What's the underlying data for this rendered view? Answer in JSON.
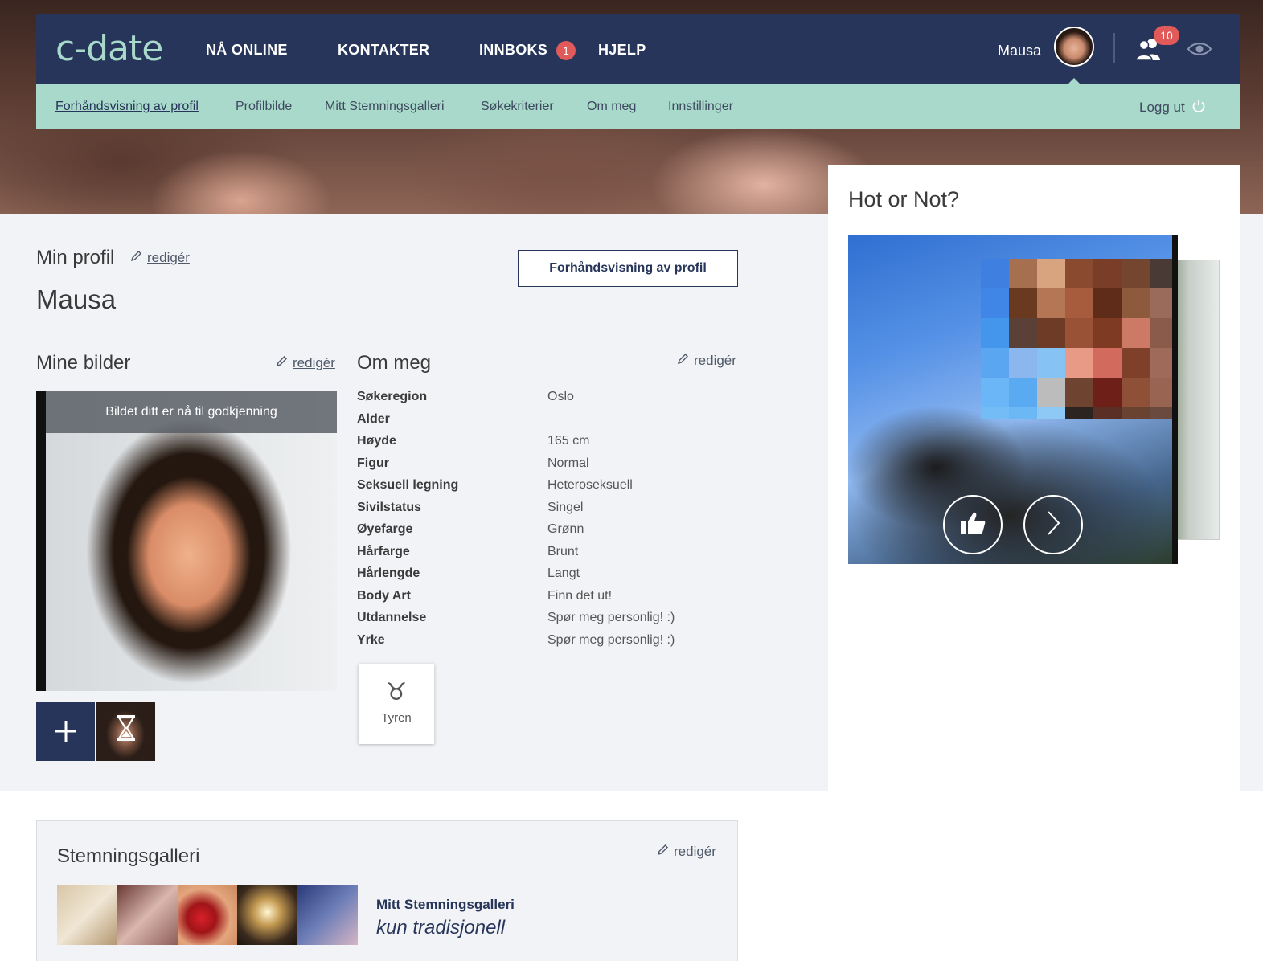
{
  "brand": {
    "logo": "c-date",
    "accent": "#263559",
    "subnav_bg": "#a9d9cb",
    "badge_color": "#e05a5a"
  },
  "topnav": {
    "items": [
      {
        "label": "NÅ ONLINE"
      },
      {
        "label": "KONTAKTER"
      },
      {
        "label": "INNBOKS",
        "badge": "1"
      },
      {
        "label": "HJELP"
      }
    ],
    "username": "Mausa",
    "contacts_badge": "10",
    "icons": [
      "avatar",
      "contacts-icon",
      "eye-icon"
    ]
  },
  "subnav": {
    "items": [
      {
        "label": "Forhåndsvisning av profil",
        "active": true
      },
      {
        "label": "Profilbilde"
      },
      {
        "label": "Mitt Stemningsgalleri"
      },
      {
        "label": "Søkekriterier"
      },
      {
        "label": "Om meg"
      },
      {
        "label": "Innstillinger"
      }
    ],
    "logout": "Logg ut"
  },
  "profile": {
    "section_title": "Min profil",
    "edit_label": "redigér",
    "name": "Mausa",
    "preview_button": "Forhåndsvisning av profil"
  },
  "photos": {
    "title": "Mine bilder",
    "edit_label": "redigér",
    "pending_banner": "Bildet ditt er nå til godkjenning",
    "add_icon": "plus-icon",
    "thumb_status_icon": "hourglass-icon"
  },
  "about": {
    "title": "Om meg",
    "edit_label": "redigér",
    "rows": [
      {
        "label": "Søkeregion",
        "value": "Oslo"
      },
      {
        "label": "Alder",
        "value": ""
      },
      {
        "label": "Høyde",
        "value": "165 cm"
      },
      {
        "label": "Figur",
        "value": "Normal"
      },
      {
        "label": "Seksuell legning",
        "value": "Heteroseksuell"
      },
      {
        "label": "Sivilstatus",
        "value": "Singel"
      },
      {
        "label": "Øyefarge",
        "value": "Grønn"
      },
      {
        "label": "Hårfarge",
        "value": "Brunt"
      },
      {
        "label": "Hårlengde",
        "value": "Langt"
      },
      {
        "label": "Body Art",
        "value": "Finn det ut!"
      },
      {
        "label": "Utdannelse",
        "value": "Spør meg personlig! :)"
      },
      {
        "label": "Yrke",
        "value": "Spør meg personlig! :)"
      }
    ],
    "zodiac": {
      "symbol": "♉",
      "label": "Tyren"
    }
  },
  "hot_or_not": {
    "title": "Hot or Not?",
    "buttons": [
      "thumbs-up-icon",
      "chevron-right-icon"
    ]
  },
  "gallery": {
    "title": "Stemningsgalleri",
    "edit_label": "redigér",
    "name": "Mitt Stemningsgalleri",
    "subtitle": "kun tradisjonell"
  }
}
